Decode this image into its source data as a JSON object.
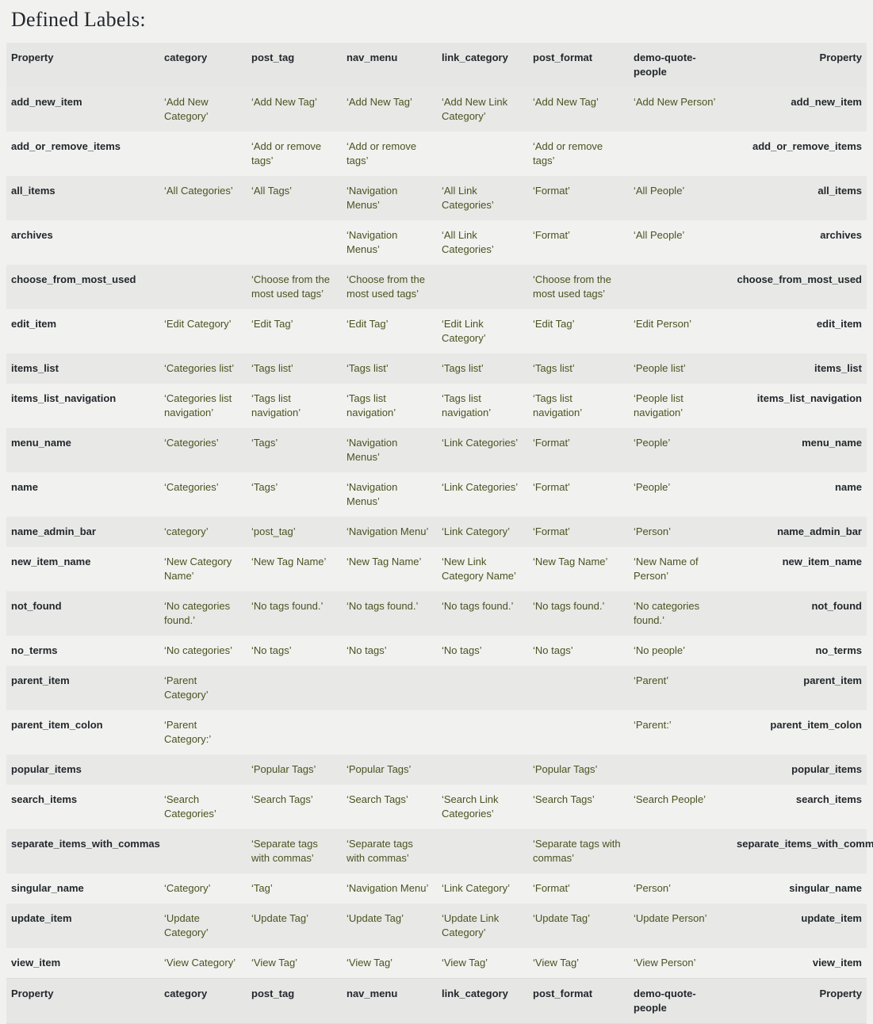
{
  "page": {
    "title": "Defined Labels:"
  },
  "table": {
    "columns": [
      "Property",
      "category",
      "post_tag",
      "nav_menu",
      "link_category",
      "post_format",
      "demo-quote-people",
      "Property"
    ],
    "rows": [
      {
        "property": "add_new_item",
        "category": "‘Add New Category’",
        "post_tag": "‘Add New Tag’",
        "nav_menu": "‘Add New Tag’",
        "link_category": "‘Add New Link Category’",
        "post_format": "‘Add New Tag’",
        "demo_quote_people": "‘Add New Person’"
      },
      {
        "property": "add_or_remove_items",
        "category": "",
        "post_tag": "‘Add or remove tags’",
        "nav_menu": "‘Add or remove tags’",
        "link_category": "",
        "post_format": "‘Add or remove tags’",
        "demo_quote_people": ""
      },
      {
        "property": "all_items",
        "category": "‘All Categories’",
        "post_tag": "‘All Tags’",
        "nav_menu": "‘Navigation Menus’",
        "link_category": "‘All Link Categories’",
        "post_format": "‘Format’",
        "demo_quote_people": "‘All People’"
      },
      {
        "property": "archives",
        "category": "",
        "post_tag": "",
        "nav_menu": "‘Navigation Menus’",
        "link_category": "‘All Link Categories’",
        "post_format": "‘Format’",
        "demo_quote_people": "‘All People’"
      },
      {
        "property": "choose_from_most_used",
        "category": "",
        "post_tag": "‘Choose from the most used tags’",
        "nav_menu": "‘Choose from the most used tags’",
        "link_category": "",
        "post_format": "‘Choose from the most used tags’",
        "demo_quote_people": ""
      },
      {
        "property": "edit_item",
        "category": "‘Edit Category’",
        "post_tag": "‘Edit Tag’",
        "nav_menu": "‘Edit Tag’",
        "link_category": "‘Edit Link Category’",
        "post_format": "‘Edit Tag’",
        "demo_quote_people": "‘Edit Person’"
      },
      {
        "property": "items_list",
        "category": "‘Categories list’",
        "post_tag": "‘Tags list’",
        "nav_menu": "‘Tags list’",
        "link_category": "‘Tags list’",
        "post_format": "‘Tags list’",
        "demo_quote_people": "‘People list’"
      },
      {
        "property": "items_list_navigation",
        "category": "‘Categories list navigation’",
        "post_tag": "‘Tags list navigation’",
        "nav_menu": "‘Tags list navigation’",
        "link_category": "‘Tags list navigation’",
        "post_format": "‘Tags list navigation’",
        "demo_quote_people": "‘People list navigation’"
      },
      {
        "property": "menu_name",
        "category": "‘Categories’",
        "post_tag": "‘Tags’",
        "nav_menu": "‘Navigation Menus’",
        "link_category": "‘Link Categories’",
        "post_format": "‘Format’",
        "demo_quote_people": "‘People’"
      },
      {
        "property": "name",
        "category": "‘Categories’",
        "post_tag": "‘Tags’",
        "nav_menu": "‘Navigation Menus’",
        "link_category": "‘Link Categories’",
        "post_format": "‘Format’",
        "demo_quote_people": "‘People’"
      },
      {
        "property": "name_admin_bar",
        "category": "‘category’",
        "post_tag": "‘post_tag’",
        "nav_menu": "‘Navigation Menu’",
        "link_category": "‘Link Category’",
        "post_format": "‘Format’",
        "demo_quote_people": "‘Person’"
      },
      {
        "property": "new_item_name",
        "category": "‘New Category Name’",
        "post_tag": "‘New Tag Name’",
        "nav_menu": "‘New Tag Name’",
        "link_category": "‘New Link Category Name’",
        "post_format": "‘New Tag Name’",
        "demo_quote_people": "‘New Name of Person’"
      },
      {
        "property": "not_found",
        "category": "‘No categories found.’",
        "post_tag": "‘No tags found.’",
        "nav_menu": "‘No tags found.’",
        "link_category": "‘No tags found.’",
        "post_format": "‘No tags found.’",
        "demo_quote_people": "‘No categories found.’"
      },
      {
        "property": "no_terms",
        "category": "‘No categories’",
        "post_tag": "‘No tags’",
        "nav_menu": "‘No tags’",
        "link_category": "‘No tags’",
        "post_format": "‘No tags’",
        "demo_quote_people": "‘No people’"
      },
      {
        "property": "parent_item",
        "category": "‘Parent Category’",
        "post_tag": "",
        "nav_menu": "",
        "link_category": "",
        "post_format": "",
        "demo_quote_people": "‘Parent’"
      },
      {
        "property": "parent_item_colon",
        "category": "‘Parent Category:’",
        "post_tag": "",
        "nav_menu": "",
        "link_category": "",
        "post_format": "",
        "demo_quote_people": "‘Parent:’"
      },
      {
        "property": "popular_items",
        "category": "",
        "post_tag": "‘Popular Tags’",
        "nav_menu": "‘Popular Tags’",
        "link_category": "",
        "post_format": "‘Popular Tags’",
        "demo_quote_people": ""
      },
      {
        "property": "search_items",
        "category": "‘Search Categories’",
        "post_tag": "‘Search Tags’",
        "nav_menu": "‘Search Tags’",
        "link_category": "‘Search Link Categories’",
        "post_format": "‘Search Tags’",
        "demo_quote_people": "‘Search People’"
      },
      {
        "property": "separate_items_with_commas",
        "category": "",
        "post_tag": "‘Separate tags with commas’",
        "nav_menu": "‘Separate tags with commas’",
        "link_category": "",
        "post_format": "‘Separate tags with commas’",
        "demo_quote_people": ""
      },
      {
        "property": "singular_name",
        "category": "‘Category’",
        "post_tag": "‘Tag’",
        "nav_menu": "‘Navigation Menu’",
        "link_category": "‘Link Category’",
        "post_format": "‘Format’",
        "demo_quote_people": "‘Person’"
      },
      {
        "property": "update_item",
        "category": "‘Update Category’",
        "post_tag": "‘Update Tag’",
        "nav_menu": "‘Update Tag’",
        "link_category": "‘Update Link Category’",
        "post_format": "‘Update Tag’",
        "demo_quote_people": "‘Update Person’"
      },
      {
        "property": "view_item",
        "category": "‘View Category’",
        "post_tag": "‘View Tag’",
        "nav_menu": "‘View Tag’",
        "link_category": "‘View Tag’",
        "post_format": "‘View Tag’",
        "demo_quote_people": "‘View Person’"
      }
    ]
  },
  "colors": {
    "page_background": "#f1f1ef",
    "header_background": "#e6e6e4",
    "row_odd": "#e8e8e6",
    "row_even": "#f1f1ef",
    "value_text": "#4b5320",
    "property_text": "#23282d",
    "rule": "#dcdcda"
  }
}
